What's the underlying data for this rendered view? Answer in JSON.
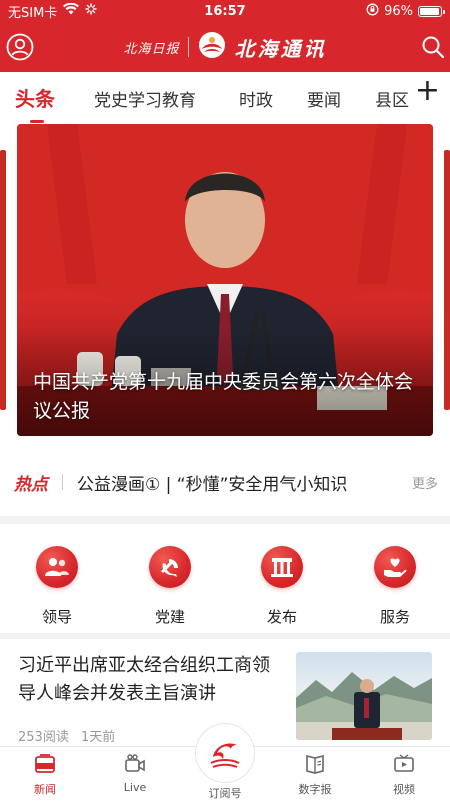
{
  "status_bar": {
    "carrier": "无SIM卡",
    "time": "16:57",
    "battery": "96%",
    "battery_level": 0.96
  },
  "app_bar": {
    "brand_left": "北海日报",
    "brand_main": "北海通讯"
  },
  "tabs": [
    {
      "label": "头条",
      "active": true
    },
    {
      "label": "党史学习教育",
      "active": false
    },
    {
      "label": "时政",
      "active": false
    },
    {
      "label": "要闻",
      "active": false
    },
    {
      "label": "县区",
      "active": false
    }
  ],
  "tab_add": "+",
  "banner": {
    "title": "中国共产党第十九届中央委员会第六次全体会议公报"
  },
  "hot": {
    "tag": "热点",
    "text": "公益漫画① | “秒懂”安全用气小知识",
    "more": "更多"
  },
  "quick_links": [
    {
      "label": "领导",
      "icon": "people-icon"
    },
    {
      "label": "党建",
      "icon": "party-emblem-icon"
    },
    {
      "label": "发布",
      "icon": "podium-icon"
    },
    {
      "label": "服务",
      "icon": "heart-hand-icon"
    }
  ],
  "news": {
    "title": "习近平出席亚太经合组织工商领导人峰会并发表主旨演讲",
    "reads": "253阅读",
    "time": "1天前"
  },
  "bottom_nav": [
    {
      "label": "新闻",
      "icon": "news-icon",
      "active": true
    },
    {
      "label": "Live",
      "icon": "camera-icon",
      "active": false
    },
    {
      "label": "订阅号",
      "icon": "dolphin-icon",
      "active": false
    },
    {
      "label": "数字报",
      "icon": "newspaper-icon",
      "active": false
    },
    {
      "label": "视频",
      "icon": "tv-icon",
      "active": false
    }
  ],
  "colors": {
    "brand_red": "#d8272c"
  }
}
